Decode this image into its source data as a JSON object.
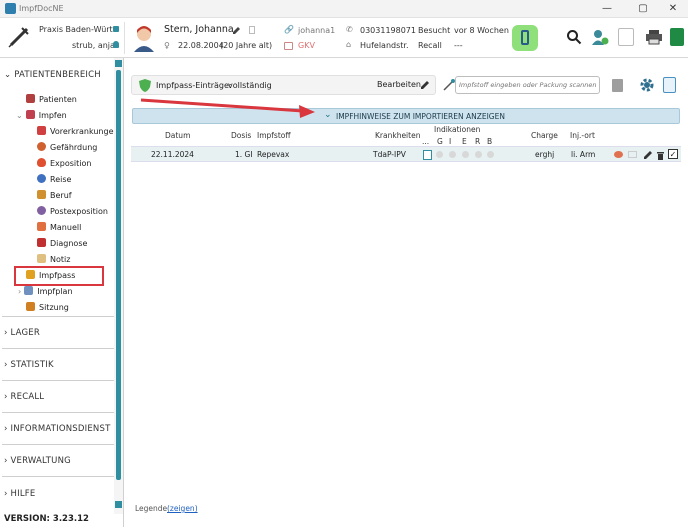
{
  "window": {
    "title": "ImpfDocNE",
    "minimize": "—",
    "maximize": "▢",
    "close": "✕"
  },
  "header": {
    "practice_name": "Praxis Baden-Würt..",
    "user_name": "strub, anja",
    "patient_name": "Stern, Johanna",
    "birthdate": "22.08.2004",
    "age": "(20 Jahre alt)",
    "username": "johanna1",
    "insurance": "GKV",
    "phone": "03031198071",
    "street": "Hufelandstr.",
    "visited_label": "Besucht",
    "visited_value": "vor 8 Wochen",
    "recall_label": "Recall",
    "recall_value": "---"
  },
  "sidebar": {
    "section_patient": "PATIENTENBEREICH",
    "items": [
      {
        "label": "Patienten",
        "color": "#b04040"
      },
      {
        "label": "Impfen",
        "color": "#c04050"
      },
      {
        "label": "Vorerkrankungen",
        "color": "#d04040"
      },
      {
        "label": "Gefährdung",
        "color": "#d06030"
      },
      {
        "label": "Exposition",
        "color": "#e05030"
      },
      {
        "label": "Reise",
        "color": "#4070c0"
      },
      {
        "label": "Beruf",
        "color": "#d09030"
      },
      {
        "label": "Postexposition",
        "color": "#8060a0"
      },
      {
        "label": "Manuell",
        "color": "#e07040"
      },
      {
        "label": "Diagnose",
        "color": "#c03030"
      },
      {
        "label": "Notiz",
        "color": "#e0c080"
      },
      {
        "label": "Impfpass",
        "color": "#e0a020"
      },
      {
        "label": "Impfplan",
        "color": "#7090c0"
      },
      {
        "label": "Sitzung",
        "color": "#d08020"
      }
    ],
    "sections": [
      "LAGER",
      "STATISTIK",
      "RECALL",
      "INFORMATIONSDIENST",
      "VERWALTUNG",
      "HILFE"
    ],
    "version": "VERSION: 3.23.12"
  },
  "main": {
    "entries_label": "Impfpass-Einträge:",
    "entries_status": "vollständig",
    "edit_label": "Bearbeiten",
    "search_placeholder": "Impfstoff eingeben oder Packung scannen",
    "import_banner": "IMPFHINWEISE ZUM IMPORTIEREN ANZEIGEN",
    "columns": {
      "datum": "Datum",
      "dosis": "Dosis",
      "impfstoff": "Impfstoff",
      "krankheiten": "Krankheiten",
      "indikationen": "Indikationen",
      "ind_letters": [
        "...",
        "G",
        "I",
        "E",
        "R",
        "B"
      ],
      "charge": "Charge",
      "injort": "Inj.-ort"
    },
    "rows": [
      {
        "datum": "22.11.2024",
        "dosis": "1. GI",
        "impfstoff": "Repevax",
        "krankheiten": "TdaP-IPV",
        "charge": "erghj",
        "injort": "li. Arm"
      }
    ],
    "legend_label": "Legende",
    "legend_link": "(zeigen)",
    "accent": "#2f8fa0",
    "highlight": "#d9363e"
  }
}
